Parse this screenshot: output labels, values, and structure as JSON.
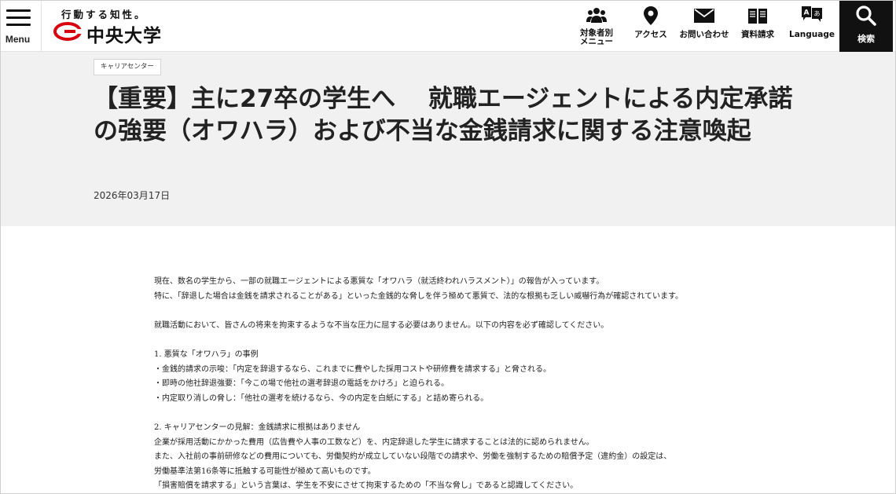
{
  "header": {
    "menu_label": "Menu",
    "tagline": "行動する知性。",
    "university_name": "中央大学",
    "brand_color": "#d7000f",
    "nav": [
      {
        "label": "対象者別\nメニュー",
        "icon": "people-icon"
      },
      {
        "label": "アクセス",
        "icon": "map-pin-icon"
      },
      {
        "label": "お問い合わせ",
        "icon": "mail-icon"
      },
      {
        "label": "資料請求",
        "icon": "book-icon"
      },
      {
        "label": "Language",
        "icon": "language-icon"
      }
    ],
    "search_label": "検索"
  },
  "article": {
    "category": "キャリアセンター",
    "title": "【重要】主に27卒の学生へ　 就職エージェントによる内定承諾の強要（オワハラ）および不当な金銭請求に関する注意喚起",
    "date": "2026年03月17日",
    "paragraphs": [
      "現在、数名の学生から、一部の就職エージェントによる悪質な「オワハラ（就活終われハラスメント）」の報告が入っています。",
      "特に、「辞退した場合は金銭を請求されることがある」といった金銭的な脅しを伴う極めて悪質で、法的な根拠も乏しい威嚇行為が確認されています。",
      "",
      "就職活動において、皆さんの将来を拘束するような不当な圧力に屈する必要はありません。以下の内容を必ず確認してください。",
      "",
      "1. 悪質な「オワハラ」の事例",
      "・金銭的請求の示唆：「内定を辞退するなら、これまでに費やした採用コストや研修費を請求する」と脅される。",
      "・即時の他社辞退強要：「今この場で他社の選考辞退の電話をかけろ」と迫られる。",
      "・内定取り消しの脅し：「他社の選考を続けるなら、今の内定を白紙にする」と詰め寄られる。",
      "",
      "2. キャリアセンターの見解：金銭請求に根拠はありません",
      "企業が採用活動にかかった費用（広告費や人事の工数など）を、内定辞退した学生に請求することは法的に認められません。",
      "また、入社前の事前研修などの費用についても、労働契約が成立していない段階での請求や、労働を強制するための賠償予定（違約金）の設定は、",
      "労働基準法第16条等に抵触する可能性が極めて高いものです。",
      "「損害賠償を請求する」という言葉は、学生を不安にさせて拘束するための「不当な脅し」であると認識してください。"
    ]
  }
}
